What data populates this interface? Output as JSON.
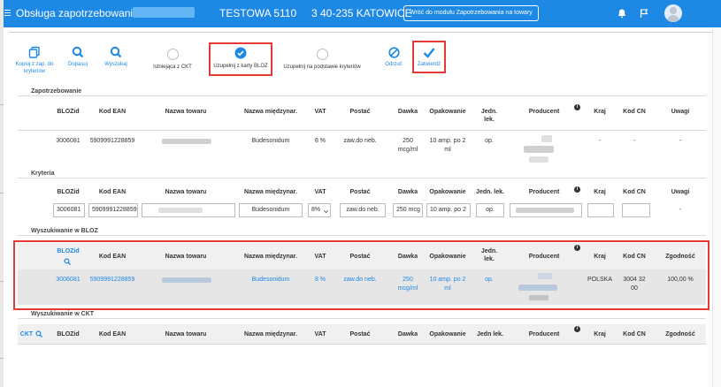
{
  "header": {
    "title": "Obsługa zapotrzebowania z:",
    "street": "TESTOWA 5110",
    "city": "3 40-235 KATOWICE",
    "back_button": "Wróć do modułu Zapotrzebowania na towary",
    "icons": [
      "bell-icon",
      "flag-icon",
      "user-avatar"
    ]
  },
  "toolbar": {
    "copy": "Kopiuj z zap. do kryteriów",
    "fit": "Dopasuj",
    "search": "Wyszukaj",
    "existing_ckt": "Istniejąca z CKT",
    "fill_bloz": "Uzupełnij z karty BLOZ",
    "fill_criteria": "Uzupełnij na podstawie kryteriów",
    "reject": "Odrzuć",
    "approve": "Zatwierdź"
  },
  "columns": [
    "BLOZid",
    "Kod EAN",
    "Nazwa towaru",
    "Nazwa międzynar.",
    "VAT",
    "Postać",
    "Dawka",
    "Opakowanie",
    "Jedn. lek.",
    "Producent",
    "Kraj",
    "Kod CN",
    "Uwagi"
  ],
  "sections": {
    "zapotrzebowanie": {
      "title": "Zapotrzebowanie",
      "row": {
        "bloz": "3006081",
        "ean": "5909991228859",
        "intl": "Budesonidum",
        "vat": "8 %",
        "form": "zaw.do neb.",
        "dose_1": "250",
        "dose_2": "mcg/ml",
        "pack_1": "10 amp. po 2",
        "pack_2": "ml",
        "unit": "op.",
        "country": "-",
        "cn": "-",
        "notes": "-"
      }
    },
    "kryteria": {
      "title": "Kryteria",
      "row": {
        "bloz": "3006081",
        "ean": "5909991228859",
        "intl": "Budesonidum",
        "vat": "8%",
        "form": "zaw.do neb.",
        "dose": "250 mcg",
        "pack": "10 amp. po 2",
        "unit": "op.",
        "notes": "-"
      }
    },
    "bloz": {
      "title": "Wyszukiwanie w BLOZ",
      "columns_last": "Zgodność",
      "row": {
        "bloz": "3006081",
        "ean": "5909991228859",
        "intl": "Budesonidum",
        "vat": "8 %",
        "form": "zaw.do neb.",
        "dose_1": "250",
        "dose_2": "mcg/ml",
        "pack_1": "10 amp. po 2",
        "pack_2": "ml",
        "unit": "op.",
        "country": "POLSKA",
        "cn_1": "3004 32",
        "cn_2": "00",
        "match": "100,00 %"
      }
    },
    "ckt": {
      "title": "Wyszukiwanie w CKT",
      "first_col": "CKT",
      "unit_label": "Jedn lek.",
      "columns_last": "Zgodność"
    }
  },
  "colors": {
    "accent": "#1e88e5",
    "highlight": "#e53935"
  }
}
